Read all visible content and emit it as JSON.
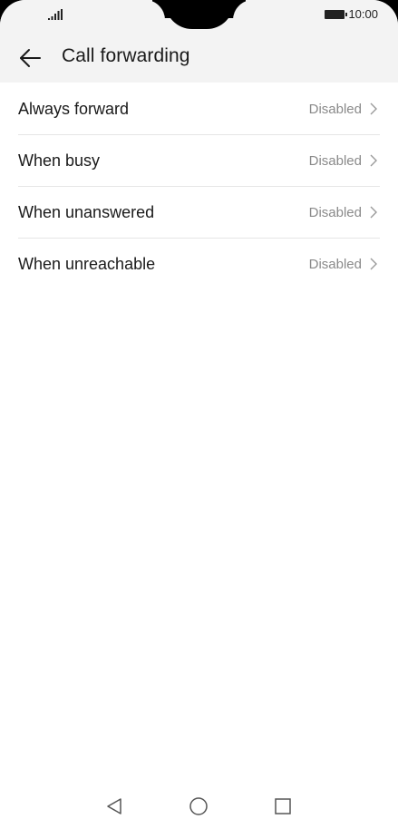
{
  "status_bar": {
    "time": "10:00",
    "signal_icon": "signal-icon",
    "battery_icon": "battery-icon"
  },
  "header": {
    "back_icon": "back-arrow-icon",
    "title": "Call forwarding"
  },
  "forwarding_options": [
    {
      "label": "Always forward",
      "value": "Disabled"
    },
    {
      "label": "When busy",
      "value": "Disabled"
    },
    {
      "label": "When unanswered",
      "value": "Disabled"
    },
    {
      "label": "When unreachable",
      "value": "Disabled"
    }
  ],
  "nav_bar": {
    "back_icon": "nav-back-triangle-icon",
    "home_icon": "nav-home-circle-icon",
    "recent_icon": "nav-recents-square-icon"
  },
  "colors": {
    "header_background": "#f3f3f3",
    "text_primary": "#1a1a1a",
    "text_secondary": "#8a8a8a",
    "divider": "#e6e6e6"
  }
}
